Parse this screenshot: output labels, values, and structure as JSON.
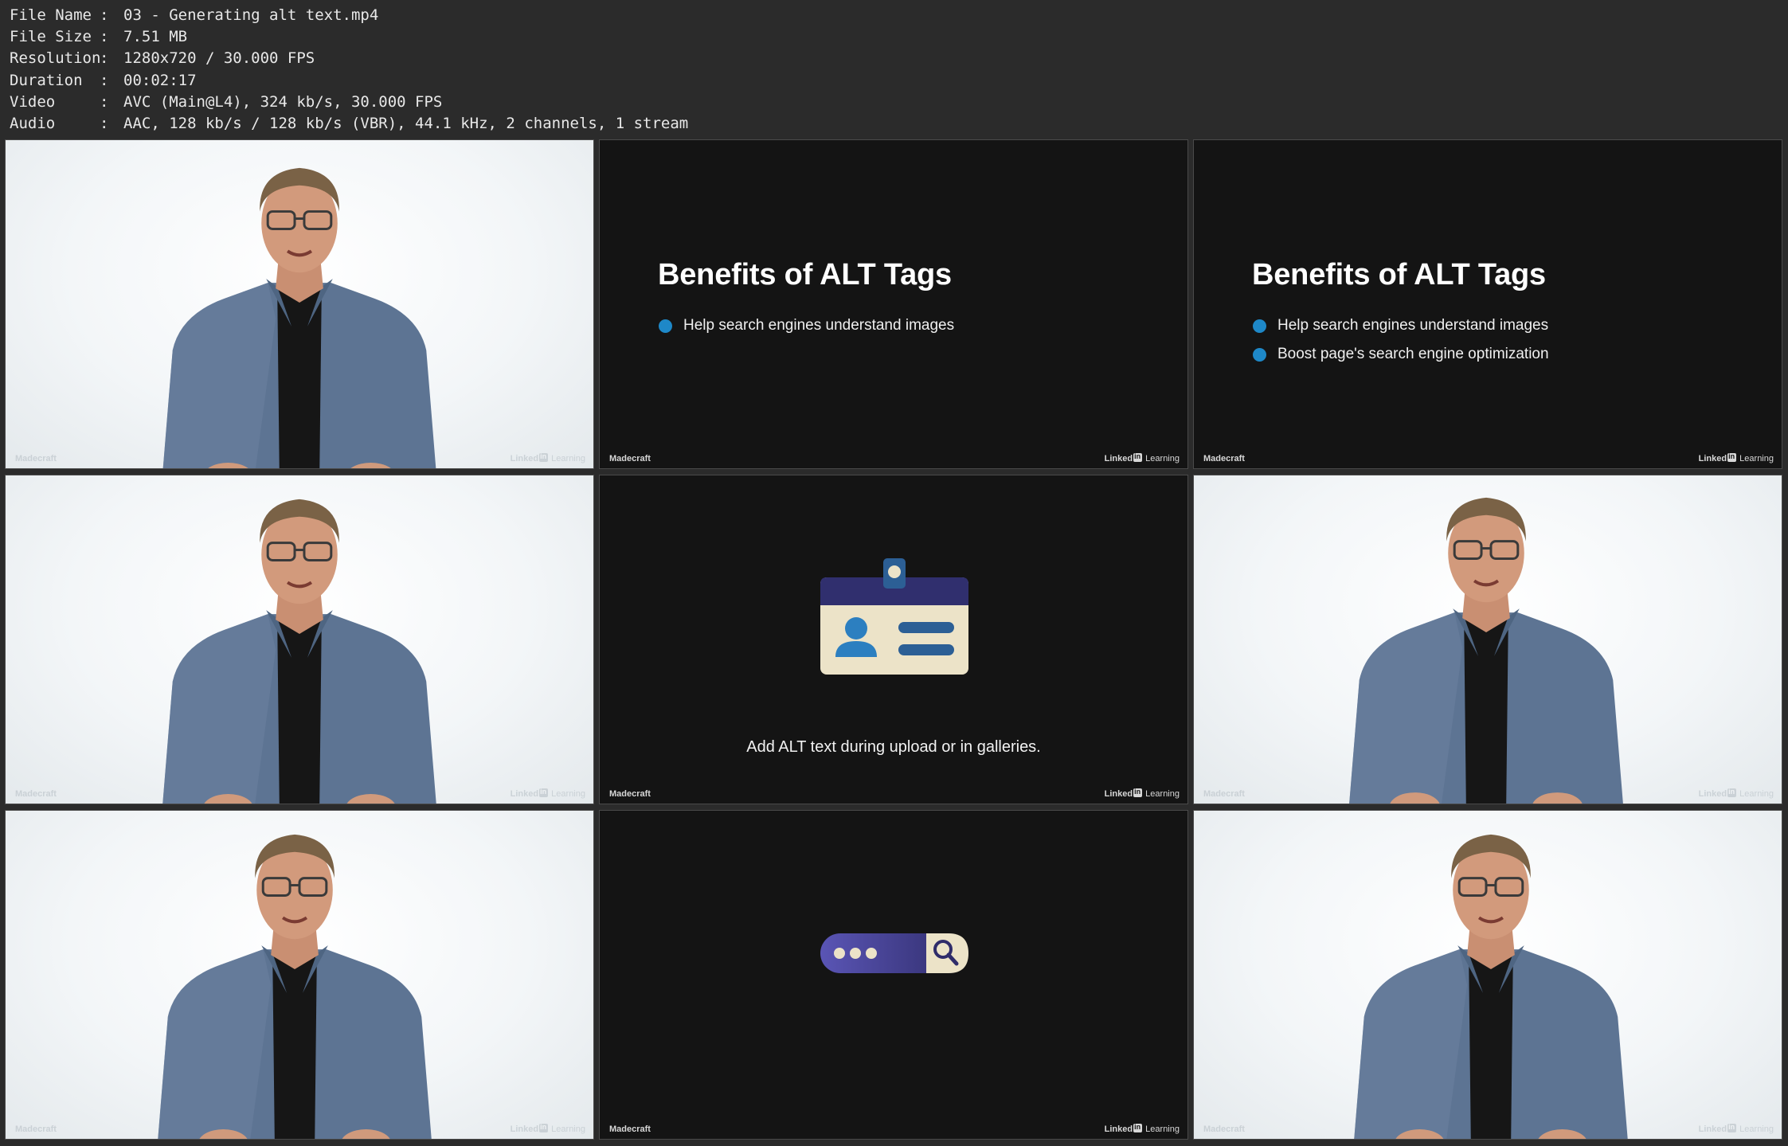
{
  "info": [
    {
      "key": "File Name",
      "value": "03 - Generating alt text.mp4"
    },
    {
      "key": "File Size",
      "value": "7.51 MB"
    },
    {
      "key": "Resolution",
      "value": "1280x720 / 30.000 FPS"
    },
    {
      "key": "Duration",
      "value": "00:02:17"
    },
    {
      "key": "Video",
      "value": "AVC (Main@L4), 324 kb/s, 30.000 FPS"
    },
    {
      "key": "Audio",
      "value": "AAC, 128 kb/s / 128 kb/s (VBR), 44.1 kHz, 2 channels, 1 stream"
    }
  ],
  "separator": ":",
  "watermark": {
    "left": "Madecraft",
    "right_linked": "Linked",
    "right_learning": "Learning"
  },
  "slides": {
    "title": "Benefits of ALT Tags",
    "bullet_1": "Help search engines understand images",
    "bullet_2": "Boost page's search engine optimization",
    "caption": "Add ALT text during upload or in galleries."
  },
  "colors": {
    "bullet": "#1e88c8",
    "shirt": "#5d7493",
    "badge_header": "#302f6e",
    "badge_body": "#ece3c8",
    "badge_accent": "#2c5f95",
    "search_bar": "#4a4aa0"
  }
}
